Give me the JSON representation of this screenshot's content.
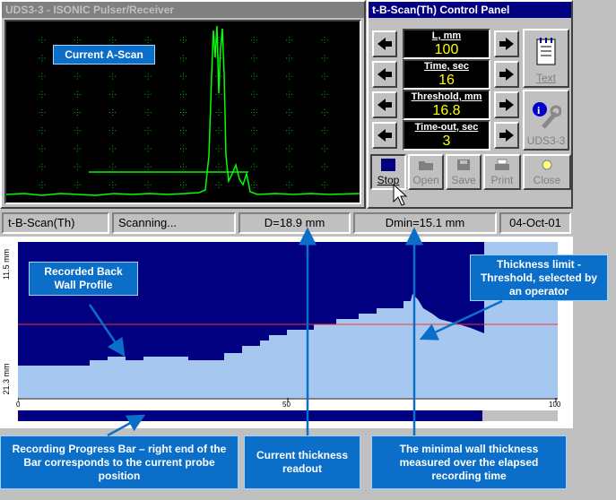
{
  "pulser_window": {
    "title": "UDS3-3 - ISONIC Pulser/Receiver"
  },
  "control_panel": {
    "title": "t-B-Scan(Th) Control Panel",
    "params": [
      {
        "label": "L, mm",
        "value": "100"
      },
      {
        "label": "Time, sec",
        "value": "16"
      },
      {
        "label": "Threshold, mm",
        "value": "16.8"
      },
      {
        "label": "Time-out, sec",
        "value": "3"
      }
    ],
    "text_button": "Text",
    "uds_button": "UDS3-3",
    "toolbar": {
      "stop": "Stop",
      "open": "Open",
      "save": "Save",
      "print": "Print",
      "close": "Close"
    }
  },
  "status_bar": {
    "mode": "t-B-Scan(Th)",
    "state": "Scanning...",
    "thickness": "D=18.9 mm",
    "dmin": "Dmin=15.1 mm",
    "date": "04-Oct-01"
  },
  "bscan": {
    "y_top": "11.5 mm",
    "y_bottom": "21.3 mm",
    "x_ticks": [
      "0",
      "50",
      "100"
    ],
    "progress_fraction": 0.86
  },
  "callouts": {
    "current_ascan": "Current A-Scan",
    "back_wall": "Recorded Back Wall Profile",
    "thickness_limit": "Thickness limit - Threshold, selected by an operator",
    "progress_bar": "Recording Progress Bar – right end of the Bar corresponds to the current probe position",
    "current_readout": "Current thickness readout",
    "min_thickness": "The minimal wall thickness measured over the elapsed recording time"
  }
}
